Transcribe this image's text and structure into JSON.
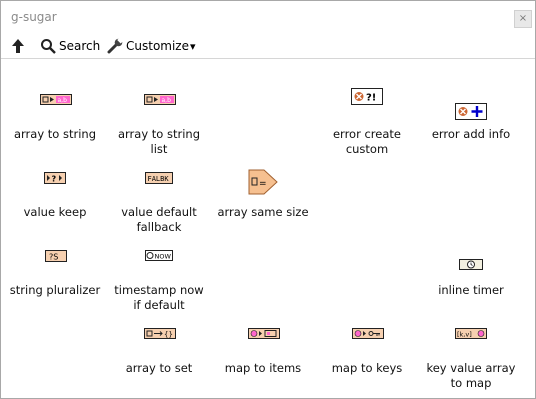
{
  "window": {
    "title": "g-sugar",
    "close_symbol": "×"
  },
  "toolbar": {
    "up_icon": "up-arrow-icon",
    "search_label": "Search",
    "customize_label": "Customize",
    "customize_arrow": "▾"
  },
  "items": [
    {
      "label_lines": [
        "array to string"
      ],
      "glyph": "[]▸a,b"
    },
    {
      "label_lines": [
        "array to string",
        "list"
      ],
      "glyph": "[]▸a,b"
    },
    {
      "label_lines": [
        "error create",
        "custom"
      ],
      "glyph": "?!"
    },
    {
      "label_lines": [
        "error add info"
      ],
      "glyph": "+"
    },
    {
      "label_lines": [
        "value keep"
      ],
      "glyph": "▸?▸"
    },
    {
      "label_lines": [
        "value default",
        "fallback"
      ],
      "glyph": "FALBK"
    },
    {
      "label_lines": [
        "array same size"
      ],
      "glyph": "[]="
    },
    {
      "label_lines": [
        "string pluralizer"
      ],
      "glyph": "?S"
    },
    {
      "label_lines": [
        "timestamp now",
        "if default"
      ],
      "glyph": "NOW"
    },
    {
      "label_lines": [
        "inline timer"
      ],
      "glyph": "⏱"
    },
    {
      "label_lines": [
        "array to set"
      ],
      "glyph": "[]→{}"
    },
    {
      "label_lines": [
        "map to items"
      ],
      "glyph": "o▸[]"
    },
    {
      "label_lines": [
        "map to keys"
      ],
      "glyph": "o▸o-"
    },
    {
      "label_lines": [
        "key value array",
        "to map"
      ],
      "glyph": "[k,v]o"
    }
  ]
}
